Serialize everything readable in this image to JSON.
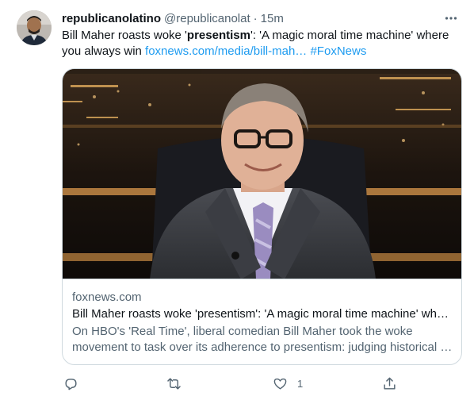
{
  "tweet": {
    "display_name": "republicanolatino",
    "handle": "@republicanolat",
    "separator": "·",
    "time": "15m",
    "text_part1": "Bill Maher roasts woke '",
    "text_bold": "presentism",
    "text_part2": "': 'A magic moral time machine' where you always win ",
    "link_url": "foxnews.com/media/bill-mah…",
    "hashtag": "#FoxNews"
  },
  "card": {
    "domain": "foxnews.com",
    "title": "Bill Maher roasts woke 'presentism': 'A magic moral time machine' wh…",
    "description": "On HBO's 'Real Time', liberal comedian Bill Maher took the woke movement to task over its adherence to presentism: judging historical …"
  },
  "actions": {
    "reply_count": "",
    "retweet_count": "",
    "like_count": "1",
    "share_count": ""
  },
  "icons": {
    "more": "more-icon",
    "reply": "reply-icon",
    "retweet": "retweet-icon",
    "like": "like-icon",
    "share": "share-icon"
  },
  "colors": {
    "link": "#1d9bf0",
    "secondary_text": "#536471",
    "primary_text": "#0f1419",
    "border": "#cfd9de"
  }
}
